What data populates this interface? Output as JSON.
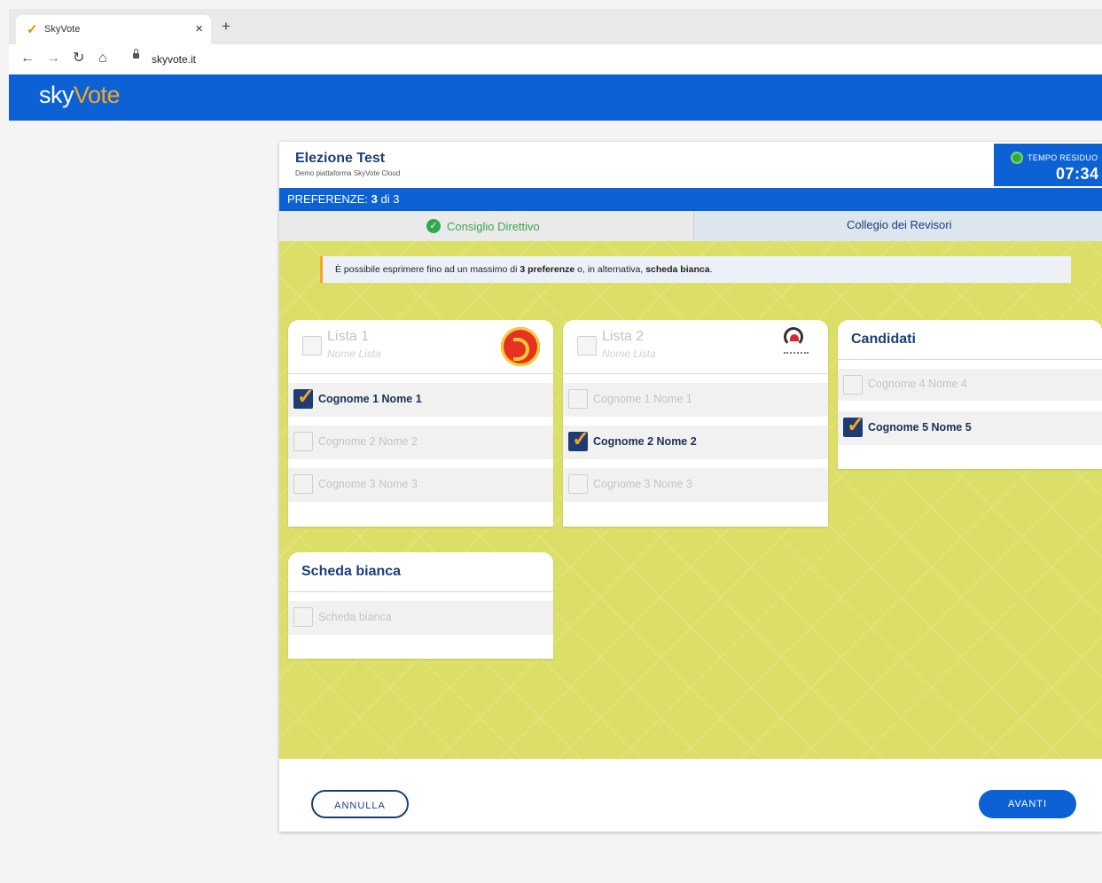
{
  "browser": {
    "tab_title": "SkyVote",
    "favicon": "✓",
    "close": "×",
    "new_tab": "+",
    "url": "skyvote.it",
    "nav": {
      "back": "←",
      "forward": "→",
      "reload": "↻",
      "home": "⌂"
    }
  },
  "app": {
    "logo_a": "sky",
    "logo_b": "Vote",
    "brand_color": "#0c62d4",
    "accent_color": "#f5a623"
  },
  "election": {
    "title": "Elezione Test",
    "subtitle": "Demo piattaforma SkyVote Cloud"
  },
  "timer": {
    "label": "TEMPO RESIDUO",
    "value": "07:34"
  },
  "preferences": {
    "label": "PREFERENZE:",
    "count": "3",
    "sep": "di",
    "max": "3"
  },
  "tabs": [
    {
      "label": "Consiglio Direttivo",
      "done": true
    },
    {
      "label": "Collegio dei Revisori",
      "done": false
    }
  ],
  "info": {
    "pre": "È possibile esprimere fino ad un massimo di ",
    "num": "3 preferenze",
    "mid": " o, in alternativa, ",
    "strong": "scheda bianca",
    "post": "."
  },
  "lists": [
    {
      "title": "Lista 1",
      "subtitle": "Nome Lista",
      "logo": "red-circle-logo",
      "candidates": [
        {
          "name": "Cognome 1 Nome 1",
          "checked": true
        },
        {
          "name": "Cognome 2 Nome 2",
          "checked": false
        },
        {
          "name": "Cognome 3 Nome 3",
          "checked": false
        }
      ]
    },
    {
      "title": "Lista 2",
      "subtitle": "Nome Lista",
      "logo": "heart-logo",
      "candidates": [
        {
          "name": "Cognome 1 Nome 1",
          "checked": false
        },
        {
          "name": "Cognome 2 Nome 2",
          "checked": true
        },
        {
          "name": "Cognome 3 Nome 3",
          "checked": false
        }
      ]
    }
  ],
  "candidati": {
    "title": "Candidati",
    "candidates": [
      {
        "name": "Cognome 4 Nome 4",
        "checked": false
      },
      {
        "name": "Cognome 5 Nome 5",
        "checked": true
      }
    ]
  },
  "blank": {
    "title": "Scheda bianca",
    "option": "Scheda bianca",
    "checked": false
  },
  "buttons": {
    "cancel": "ANNULLA",
    "next": "AVANTI"
  }
}
